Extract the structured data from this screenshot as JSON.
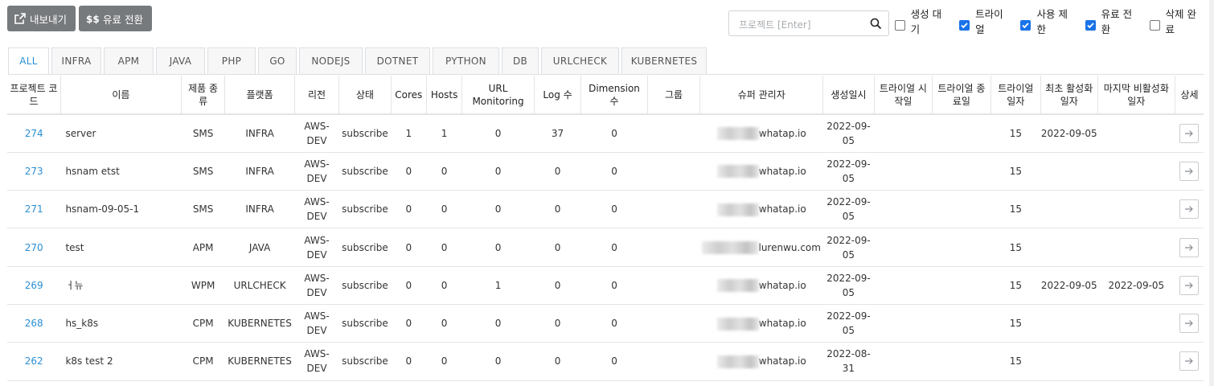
{
  "toolbar": {
    "export_label": "내보내기",
    "paid_label": "유료 전환"
  },
  "search": {
    "placeholder": "프로젝트 [Enter]"
  },
  "filters": [
    {
      "label": "생성 대기",
      "checked": false
    },
    {
      "label": "트라이얼",
      "checked": true
    },
    {
      "label": "사용 제한",
      "checked": true
    },
    {
      "label": "유료 전환",
      "checked": true
    },
    {
      "label": "삭제 완료",
      "checked": false
    }
  ],
  "tabs": [
    "ALL",
    "INFRA",
    "APM",
    "JAVA",
    "PHP",
    "GO",
    "NODEJS",
    "DOTNET",
    "PYTHON",
    "DB",
    "URLCHECK",
    "KUBERNETES"
  ],
  "active_tab": "ALL",
  "columns": [
    "프로젝트 코드",
    "이름",
    "제품 종류",
    "플랫폼",
    "리전",
    "상태",
    "Cores",
    "Hosts",
    "URL Monitoring",
    "Log 수",
    "Dimension 수",
    "그룹",
    "슈퍼 관리자",
    "생성일시",
    "트라이얼 시작일",
    "트라이얼 종료일",
    "트라이얼 일자",
    "최초 활성화 일자",
    "마지막 비활성화 일자",
    "상세"
  ],
  "rows": [
    {
      "code": "274",
      "name": "server",
      "product": "SMS",
      "platform": "INFRA",
      "region": "AWS-DEV",
      "status": "subscribe",
      "cores": "1",
      "hosts": "1",
      "url": "0",
      "logs": "37",
      "dim": "0",
      "group": "",
      "admin": "whatap.io",
      "created": "2022-09-05",
      "trial_start": "",
      "trial_end": "",
      "trial_days": "15",
      "first_active": "2022-09-05",
      "last_inactive": ""
    },
    {
      "code": "273",
      "name": "hsnam etst",
      "product": "SMS",
      "platform": "INFRA",
      "region": "AWS-DEV",
      "status": "subscribe",
      "cores": "0",
      "hosts": "0",
      "url": "0",
      "logs": "0",
      "dim": "0",
      "group": "",
      "admin": "whatap.io",
      "created": "2022-09-05",
      "trial_start": "",
      "trial_end": "",
      "trial_days": "15",
      "first_active": "",
      "last_inactive": ""
    },
    {
      "code": "271",
      "name": "hsnam-09-05-1",
      "product": "SMS",
      "platform": "INFRA",
      "region": "AWS-DEV",
      "status": "subscribe",
      "cores": "0",
      "hosts": "0",
      "url": "0",
      "logs": "0",
      "dim": "0",
      "group": "",
      "admin": "whatap.io",
      "created": "2022-09-05",
      "trial_start": "",
      "trial_end": "",
      "trial_days": "15",
      "first_active": "",
      "last_inactive": ""
    },
    {
      "code": "270",
      "name": "test",
      "product": "APM",
      "platform": "JAVA",
      "region": "AWS-DEV",
      "status": "subscribe",
      "cores": "0",
      "hosts": "0",
      "url": "0",
      "logs": "0",
      "dim": "0",
      "group": "",
      "admin": "lurenwu.com",
      "created": "2022-09-05",
      "trial_start": "",
      "trial_end": "",
      "trial_days": "15",
      "first_active": "",
      "last_inactive": ""
    },
    {
      "code": "269",
      "name": "ㅓ뉴",
      "product": "WPM",
      "platform": "URLCHECK",
      "region": "AWS-DEV",
      "status": "subscribe",
      "cores": "0",
      "hosts": "0",
      "url": "1",
      "logs": "0",
      "dim": "0",
      "group": "",
      "admin": "whatap.io",
      "created": "2022-09-05",
      "trial_start": "",
      "trial_end": "",
      "trial_days": "15",
      "first_active": "2022-09-05",
      "last_inactive": "2022-09-05"
    },
    {
      "code": "268",
      "name": "hs_k8s",
      "product": "CPM",
      "platform": "KUBERNETES",
      "region": "AWS-DEV",
      "status": "subscribe",
      "cores": "0",
      "hosts": "0",
      "url": "0",
      "logs": "0",
      "dim": "0",
      "group": "",
      "admin": "whatap.io",
      "created": "2022-09-05",
      "trial_start": "",
      "trial_end": "",
      "trial_days": "15",
      "first_active": "",
      "last_inactive": ""
    },
    {
      "code": "262",
      "name": "k8s test 2",
      "product": "CPM",
      "platform": "KUBERNETES",
      "region": "AWS-DEV",
      "status": "subscribe",
      "cores": "0",
      "hosts": "0",
      "url": "0",
      "logs": "0",
      "dim": "0",
      "group": "",
      "admin": "whatap.io",
      "created": "2022-08-31",
      "trial_start": "",
      "trial_end": "",
      "trial_days": "15",
      "first_active": "",
      "last_inactive": ""
    }
  ],
  "icons": {
    "export": "external-link-icon",
    "paid": "dollar-swap-icon",
    "search": "search-icon",
    "detail": "arrow-right-icon"
  },
  "colors": {
    "button_bg": "#777a7d",
    "link": "#2b8fd6",
    "checkbox": "#1a73e8"
  }
}
